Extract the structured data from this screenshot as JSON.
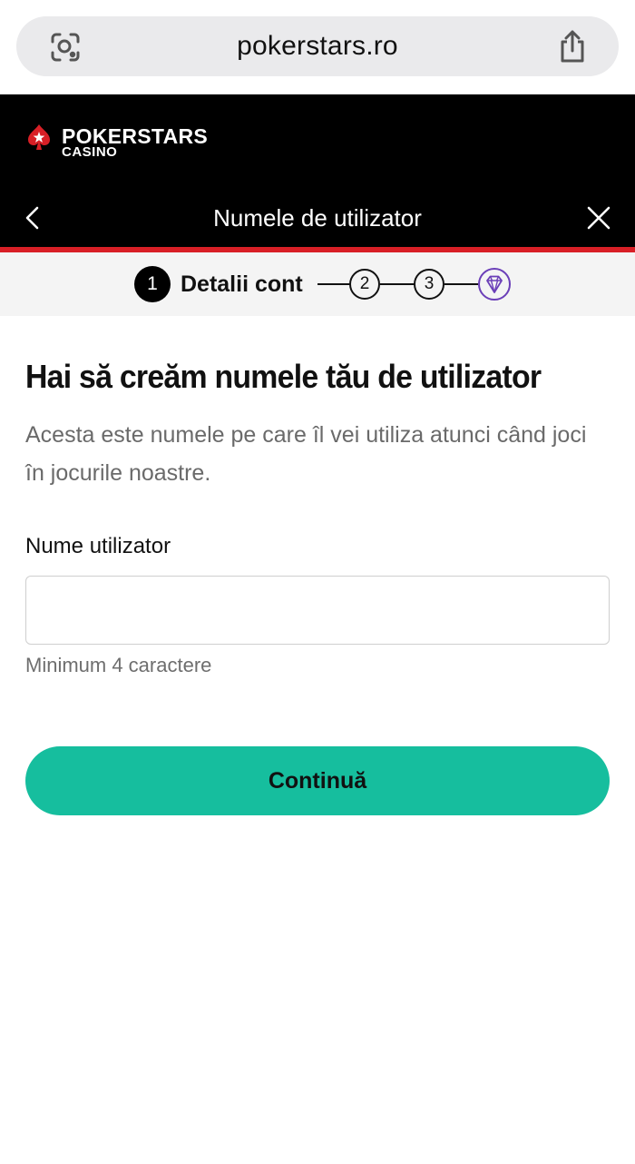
{
  "browser": {
    "url": "pokerstars.ro",
    "lens_icon": "visual-search-icon",
    "share_icon": "share-icon"
  },
  "header": {
    "logo_word": "POKERSTARS",
    "logo_sub": "CASINO",
    "title": "Numele de utilizator",
    "back_icon": "chevron-left-icon",
    "close_icon": "close-icon"
  },
  "stepper": {
    "active_number": "1",
    "active_label": "Detalii cont",
    "step2": "2",
    "step3": "3",
    "final_icon": "diamond-icon"
  },
  "form": {
    "heading": "Hai să creăm numele tău de utilizator",
    "subtext": "Acesta este numele pe care îl vei utiliza atunci când joci în jocurile noastre.",
    "field_label": "Nume utilizator",
    "username_value": "",
    "helper": "Minimum 4 caractere",
    "continue_label": "Continuă"
  },
  "colors": {
    "header_bg": "#000000",
    "accent_red": "#d81f26",
    "button_green": "#16be9e",
    "diamond_purple": "#6b3fb8"
  }
}
